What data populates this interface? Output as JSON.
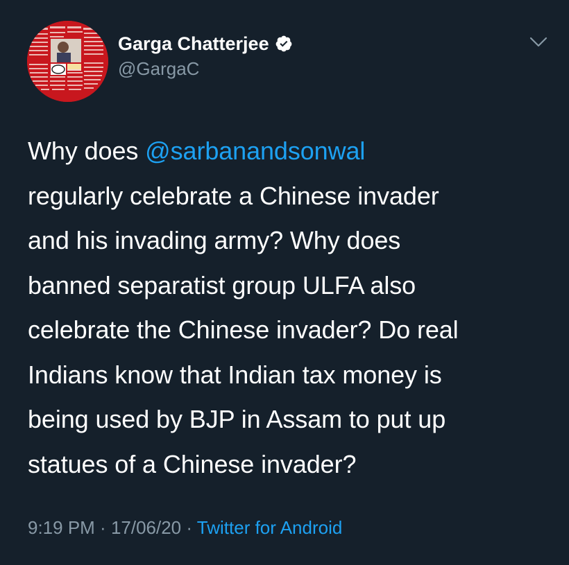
{
  "user": {
    "display_name": "Garga Chatterjee",
    "handle": "@GargaC",
    "verified": true
  },
  "tweet": {
    "line1_prefix": "Why does ",
    "line1_mention": "@sarbanandsonwal",
    "lines": [
      "regularly celebrate a Chinese invader",
      "and his invading army? Why does",
      "banned separatist group ULFA also",
      "celebrate the Chinese invader? Do real",
      "Indians know that Indian tax money is",
      "being used by BJP in Assam to put up",
      "statues of a Chinese invader?"
    ]
  },
  "meta": {
    "time": "9:19 PM",
    "separator1": " · ",
    "date": "17/06/20",
    "separator2": " · ",
    "source": "Twitter for Android"
  },
  "icons": {
    "avatar": "profile-avatar",
    "verified": "verified-badge-icon",
    "menu": "chevron-down-icon"
  },
  "colors": {
    "background": "#15202b",
    "text": "#ffffff",
    "secondary": "#8899a6",
    "link": "#1da1f2"
  }
}
